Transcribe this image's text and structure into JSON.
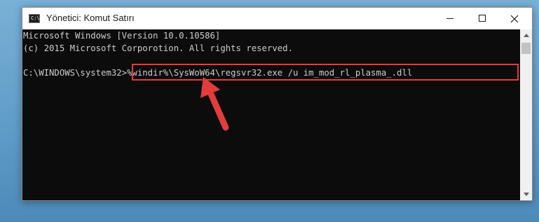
{
  "window": {
    "title": "Yönetici: Komut Satırı",
    "app_icon_glyph": "C:\\",
    "controls": [
      "minimize",
      "maximize",
      "close"
    ]
  },
  "console": {
    "lines": [
      "Microsoft Windows [Version 10.0.10586]",
      "(c) 2015 Microsoft Corporotion. All rights reserved.",
      "C:\\WINDOWS\\system32>%windir%\\SysWoW64\\regsvr32.exe /u im_mod_rl_plasma_.dll"
    ],
    "prompt": "C:\\WINDOWS\\system32>",
    "command": "%windir%\\SysWoW64\\regsvr32.exe /u im_mod_rl_plasma_.dll",
    "background_color": "#0c0c0c",
    "text_color": "#cccccc"
  },
  "annotation": {
    "highlight_color": "#e23c3c",
    "arrow_color": "#e23c3c",
    "arrow_icon": "up-left-arrow-icon"
  }
}
